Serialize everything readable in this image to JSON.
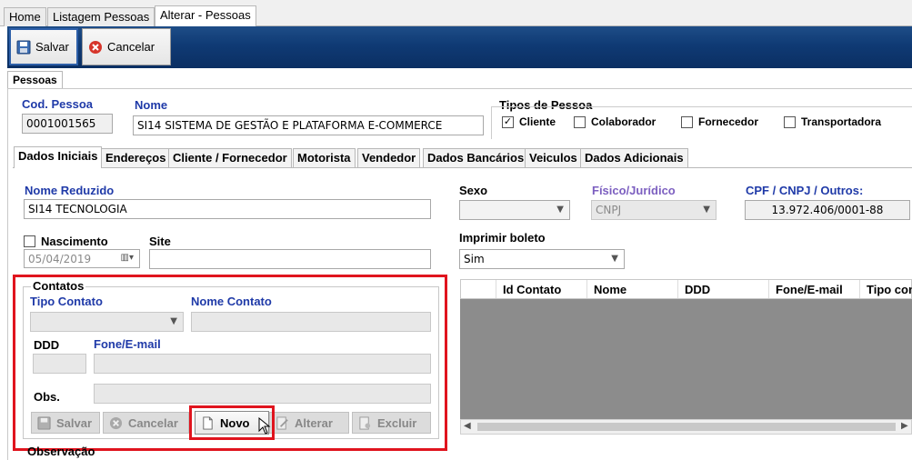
{
  "top_tabs": [
    "Home",
    "Listagem Pessoas",
    "Alterar - Pessoas"
  ],
  "toolbar": {
    "save_label": "Salvar",
    "cancel_label": "Cancelar"
  },
  "section_tab": "Pessoas",
  "person": {
    "code_label": "Cod. Pessoa",
    "code_value": "0001001565",
    "name_label": "Nome",
    "name_value": "SI14 SISTEMA DE GESTÃO E PLATAFORMA E-COMMERCE"
  },
  "person_types": {
    "label": "Tipos de Pessoa",
    "options": [
      {
        "label": "Cliente",
        "checked": true
      },
      {
        "label": "Colaborador",
        "checked": false
      },
      {
        "label": "Fornecedor",
        "checked": false
      },
      {
        "label": "Transportadora",
        "checked": false
      }
    ]
  },
  "inner_tabs": [
    "Dados Iniciais",
    "Endereços",
    "Cliente / Fornecedor",
    "Motorista",
    "Vendedor",
    "Dados Bancários",
    "Veiculos",
    "Dados Adicionais"
  ],
  "form": {
    "short_name_label": "Nome Reduzido",
    "short_name_value": "SI14 TECNOLOGIA",
    "sex_label": "Sexo",
    "sex_value": "",
    "fisjur_label": "Físico/Jurídico",
    "fisjur_value": "CNPJ",
    "doc_label": "CPF / CNPJ / Outros:",
    "doc_value": "13.972.406/0001-88",
    "birth_label": "Nascimento",
    "birth_value": "05/04/2019",
    "site_label": "Site",
    "site_value": "",
    "boleto_label": "Imprimir boleto",
    "boleto_value": "Sim"
  },
  "contacts": {
    "group_label": "Contatos",
    "type_label": "Tipo Contato",
    "name_label": "Nome Contato",
    "ddd_label": "DDD",
    "phone_label": "Fone/E-mail",
    "obs_label": "Obs.",
    "buttons": {
      "save": "Salvar",
      "cancel": "Cancelar",
      "new": "Novo",
      "edit": "Alterar",
      "delete": "Excluir"
    },
    "grid_columns": [
      "Id Contato",
      "Nome",
      "DDD",
      "Fone/E-mail",
      "Tipo con"
    ]
  },
  "observacao_label": "Observação",
  "colors": {
    "toolbar": "#0f3a74",
    "highlight": "#e0141e",
    "label_blue": "#1f3aa8"
  }
}
